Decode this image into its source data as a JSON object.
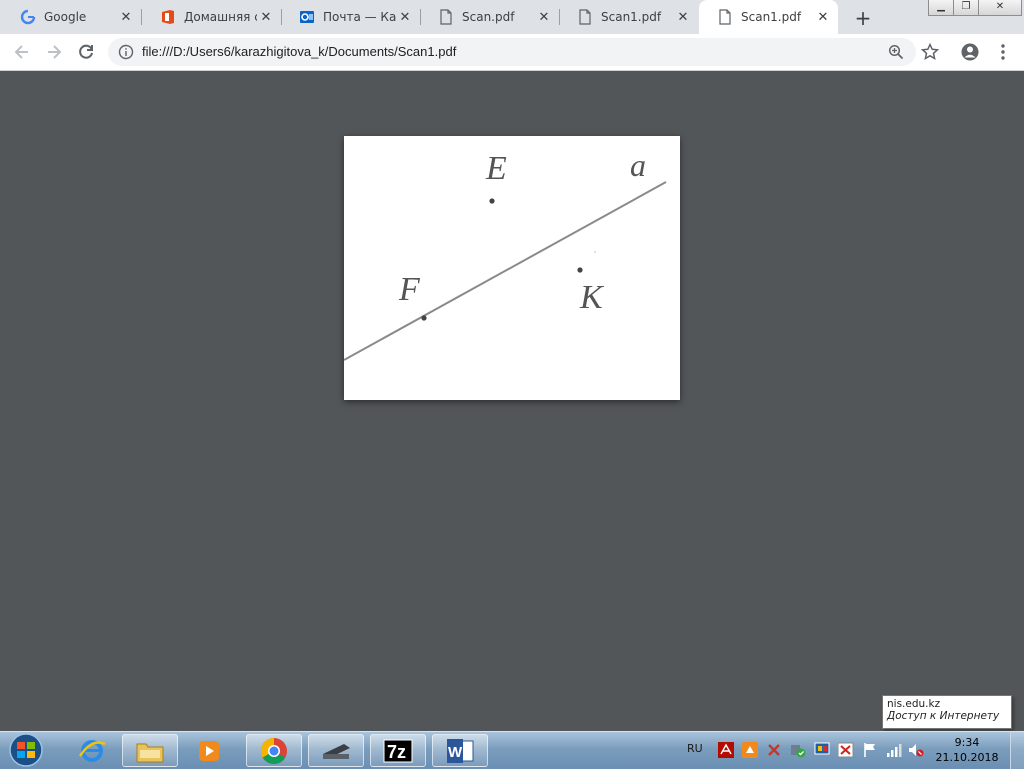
{
  "tabs": [
    {
      "title": "Google",
      "icon": "google-icon",
      "active": false
    },
    {
      "title": "Домашняя стр",
      "icon": "office-icon",
      "active": false
    },
    {
      "title": "Почта — Кара",
      "icon": "outlook-icon",
      "active": false
    },
    {
      "title": "Scan.pdf",
      "icon": "document-icon",
      "active": false
    },
    {
      "title": "Scan1.pdf",
      "icon": "document-icon",
      "active": false
    },
    {
      "title": "Scan1.pdf",
      "icon": "document-icon",
      "active": true
    }
  ],
  "toolbar": {
    "url": "file:///D:/Users6/karazhigitova_k/Documents/Scan1.pdf"
  },
  "document": {
    "labels": {
      "point_e": "E",
      "point_f": "F",
      "point_k": "K",
      "line_a": "a"
    }
  },
  "taskbar": {
    "language": "RU",
    "time": "9:34",
    "date": "21.10.2018"
  },
  "tooltip": {
    "title": "nis.edu.kz",
    "subtitle": "Доступ к Интернету"
  },
  "colors": {
    "tabstrip": "#dee1e6",
    "viewer_bg": "#525659",
    "taskbar": "#7b9dbd"
  }
}
